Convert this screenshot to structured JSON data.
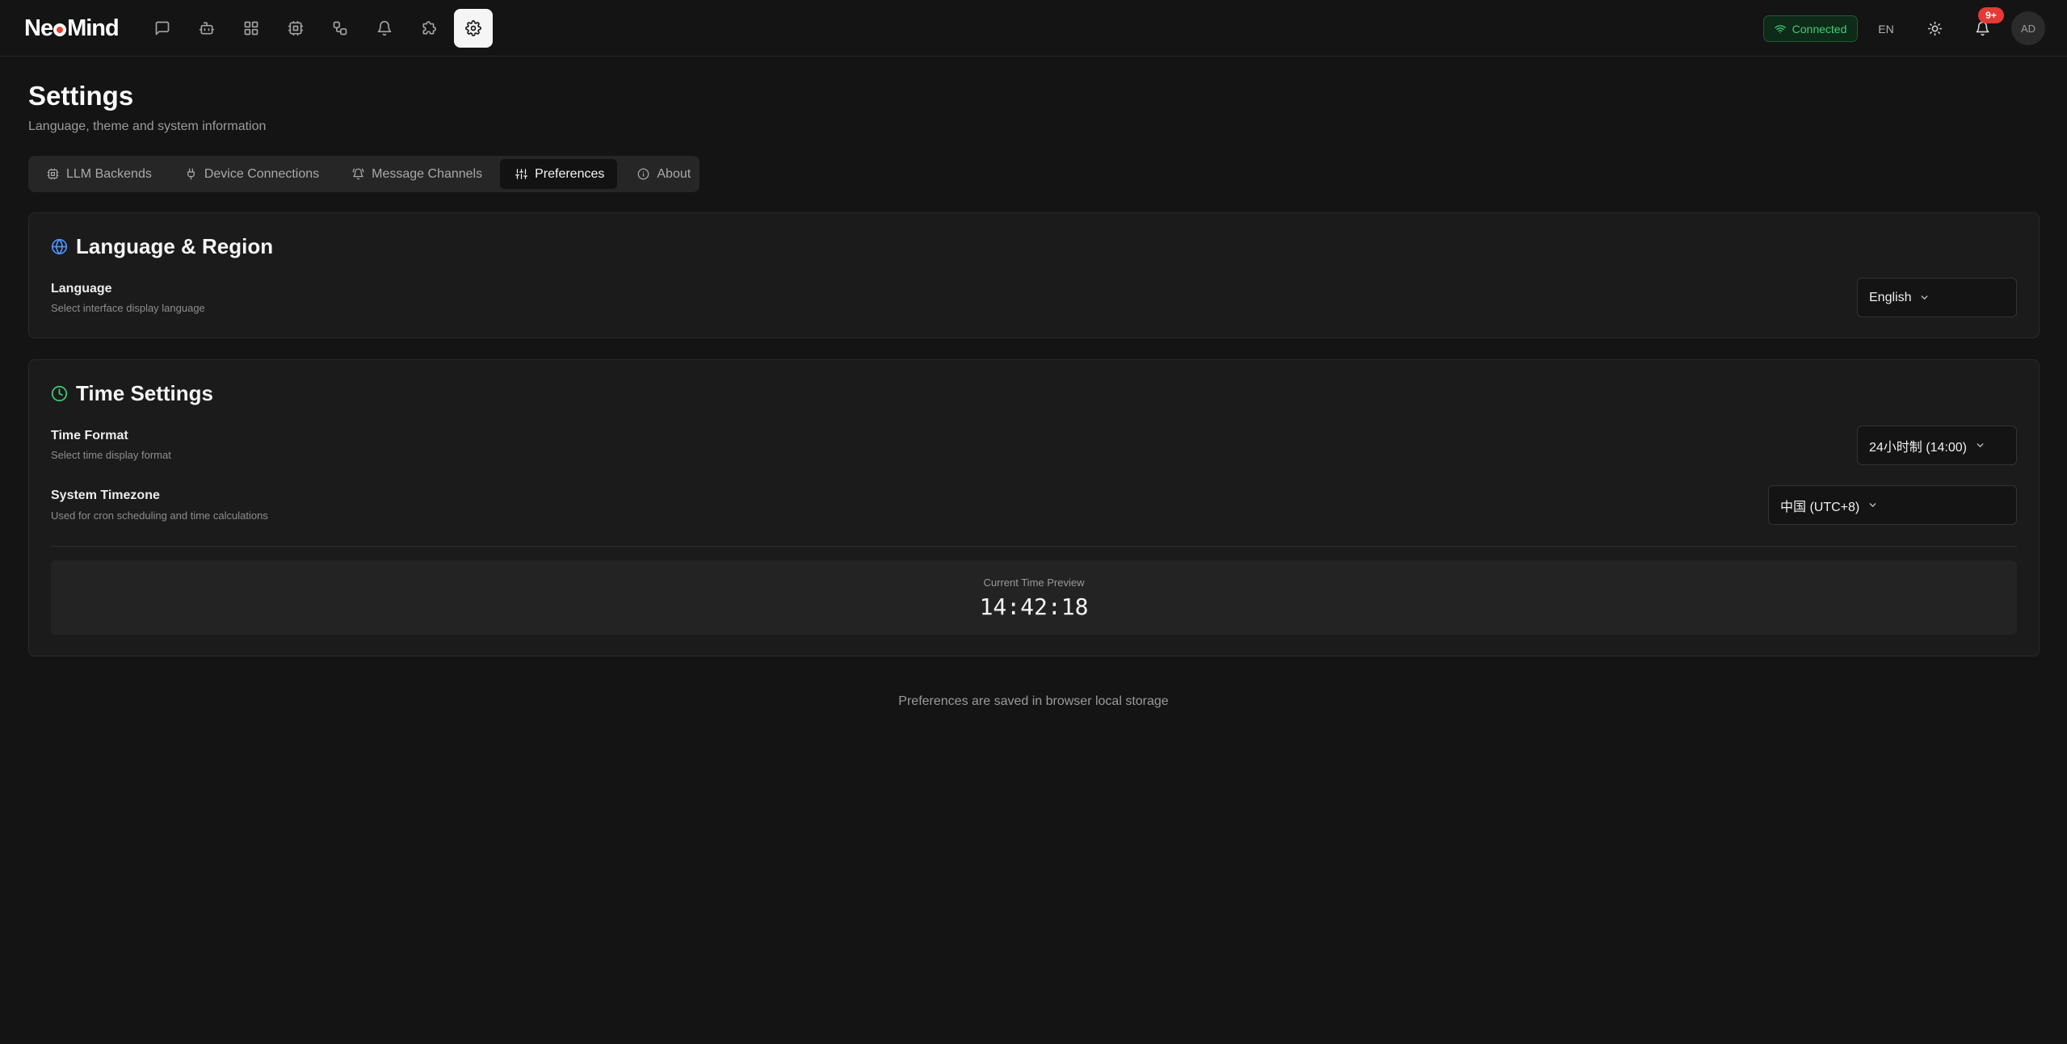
{
  "app": {
    "logo_part1": "Ne",
    "logo_part2": "Mind"
  },
  "nav": [
    {
      "name": "chat",
      "icon": "message-square-icon",
      "active": false
    },
    {
      "name": "agents",
      "icon": "bot-icon",
      "active": false
    },
    {
      "name": "dashboard",
      "icon": "layout-grid-icon",
      "active": false
    },
    {
      "name": "devices",
      "icon": "cpu-icon",
      "active": false
    },
    {
      "name": "automation",
      "icon": "workflow-icon",
      "active": false
    },
    {
      "name": "alerts",
      "icon": "bell-icon",
      "active": false
    },
    {
      "name": "plugins",
      "icon": "puzzle-icon",
      "active": false
    },
    {
      "name": "settings",
      "icon": "gear-icon",
      "active": true
    }
  ],
  "header": {
    "status": "Connected",
    "status_color": "#3ecf72",
    "language_code": "EN",
    "notification_count": "9+",
    "avatar_initials": "AD"
  },
  "page": {
    "title": "Settings",
    "subtitle": "Language, theme and system information"
  },
  "tabs": [
    {
      "label": "LLM Backends",
      "icon": "cpu-icon",
      "active": false
    },
    {
      "label": "Device Connections",
      "icon": "plug-icon",
      "active": false
    },
    {
      "label": "Message Channels",
      "icon": "bell-ring-icon",
      "active": false
    },
    {
      "label": "Preferences",
      "icon": "sliders-icon",
      "active": true
    },
    {
      "label": "About",
      "icon": "info-icon",
      "active": false
    }
  ],
  "language_card": {
    "title": "Language & Region",
    "icon": "globe-icon",
    "icon_color": "#4f8ff7",
    "language_label": "Language",
    "language_desc": "Select interface display language",
    "language_value": "English"
  },
  "time_card": {
    "title": "Time Settings",
    "icon": "clock-icon",
    "icon_color": "#3ecf72",
    "format_label": "Time Format",
    "format_desc": "Select time display format",
    "format_value": "24小时制 (14:00)",
    "timezone_label": "System Timezone",
    "timezone_desc": "Used for cron scheduling and time calculations",
    "timezone_value": "中国 (UTC+8)",
    "preview_label": "Current Time Preview",
    "preview_time": "14:42:18"
  },
  "footer_note": "Preferences are saved in browser local storage"
}
